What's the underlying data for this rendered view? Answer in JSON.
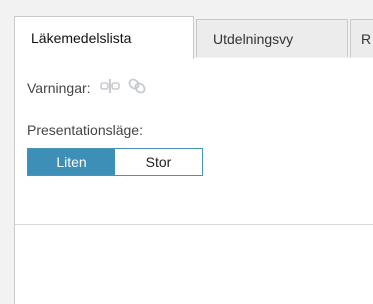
{
  "tabs": [
    {
      "label": "Läkemedelslista",
      "active": true
    },
    {
      "label": "Utdelningsvy",
      "active": false
    },
    {
      "label": "R",
      "active": false
    }
  ],
  "warnings": {
    "label": "Varningar:",
    "icons": [
      "pill-capsule-icon",
      "link-chain-icon"
    ],
    "icon_color": "#c7cbd0"
  },
  "presentation": {
    "label": "Presentationsläge:",
    "options": [
      {
        "label": "Liten",
        "selected": true
      },
      {
        "label": "Stor",
        "selected": false
      }
    ],
    "accent_color": "#3d8fb7"
  }
}
